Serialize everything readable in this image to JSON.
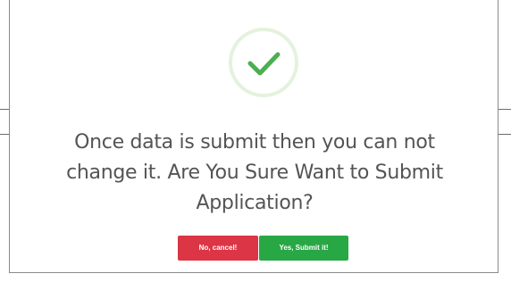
{
  "dialog": {
    "icon": "check-icon",
    "message": "Once data is submit then you can not change it. Are You Sure Want to Submit Application?",
    "cancel_label": "No, cancel!",
    "confirm_label": "Yes, Submit it!"
  },
  "colors": {
    "success": "#4caf50",
    "success_ring": "#e4f2dd",
    "cancel_button": "#dc3545",
    "confirm_button": "#28a745",
    "message_text": "#545454"
  }
}
